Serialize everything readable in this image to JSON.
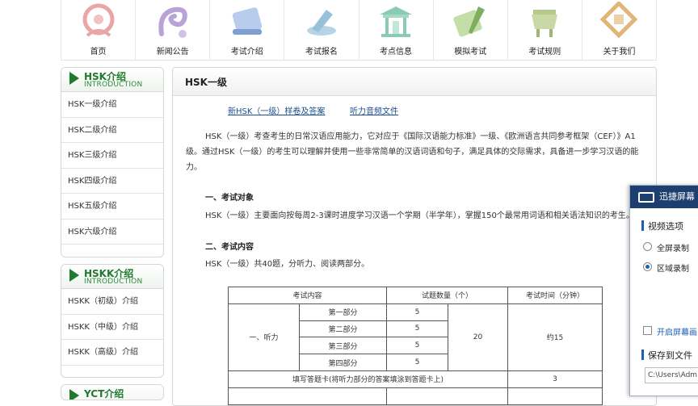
{
  "nav": {
    "items": [
      {
        "label": "首页",
        "icon": "home-emblem-icon",
        "color": "#e8a6a6"
      },
      {
        "label": "新闻公告",
        "icon": "news-swirl-icon",
        "color": "#b9a2d6"
      },
      {
        "label": "考试介绍",
        "icon": "scroll-icon",
        "color": "#9bb6dd"
      },
      {
        "label": "考试报名",
        "icon": "registration-icon",
        "color": "#98c1d9"
      },
      {
        "label": "考点信息",
        "icon": "pavilion-icon",
        "color": "#8ccbb3"
      },
      {
        "label": "模拟考试",
        "icon": "brush-icon",
        "color": "#a7c98a"
      },
      {
        "label": "考试规则",
        "icon": "tripod-icon",
        "color": "#b7c98a"
      },
      {
        "label": "关于我们",
        "icon": "seal-icon",
        "color": "#e0b67a"
      }
    ]
  },
  "sidebar": {
    "hsk": {
      "title": "HSK介绍",
      "subtitle": "INTRODUCTION",
      "items": [
        "HSK一级介绍",
        "HSK二级介绍",
        "HSK三级介绍",
        "HSK四级介绍",
        "HSK五级介绍",
        "HSK六级介绍"
      ]
    },
    "hskk": {
      "title": "HSKK介绍",
      "subtitle": "INTRODUCTION",
      "items": [
        "HSKK（初级）介绍",
        "HSKK（中级）介绍",
        "HSKK（高级）介绍"
      ]
    },
    "yct": {
      "title": "YCT介绍"
    }
  },
  "main": {
    "title": "HSK一级",
    "link_sample": "新HSK（一级）样卷及答案",
    "link_audio": "听力音频文件",
    "intro_line1": "HSK（一级）考查考生的日常汉语应用能力，它对应于《国际汉语能力标准》一级、《欧洲语言共同参考框架（CEF）》A1",
    "intro_line2": "级。通过HSK（一级）的考生可以理解并使用一些非常简单的汉语词语和句子，满足具体的交际需求，具备进一步学习汉语的能",
    "intro_line3": "力。",
    "sec1_title": "一、考试对象",
    "sec1_text": "HSK（一级）主要面向按每周2-3课时进度学习汉语一个学期（半学年），掌握150个最常用词语和相关语法知识的考生。",
    "sec2_title": "二、考试内容",
    "sec2_text": "HSK（一级）共40题，分听力、阅读两部分。"
  },
  "table": {
    "headers": [
      "考试内容",
      "试题数量（个）",
      "考试时间（分钟）"
    ],
    "section": "一、听力",
    "parts": [
      {
        "name": "第一部分",
        "count": "5"
      },
      {
        "name": "第二部分",
        "count": "5"
      },
      {
        "name": "第三部分",
        "count": "5"
      },
      {
        "name": "第四部分",
        "count": "5"
      }
    ],
    "total": "20",
    "time": "约15",
    "answer_row": "填写答题卡(将听力部分的答案填涂到答题卡上)",
    "answer_time": "3"
  },
  "popup": {
    "title": "迅捷屏幕",
    "video_header": "视频选项",
    "opt_full": "全屏录制",
    "opt_region": "区域录制",
    "mouse_opt": "开启屏幕画",
    "save_header": "保存到文件",
    "save_path": "C:\\Users\\Adm",
    "accent": "#1d3f6f"
  }
}
